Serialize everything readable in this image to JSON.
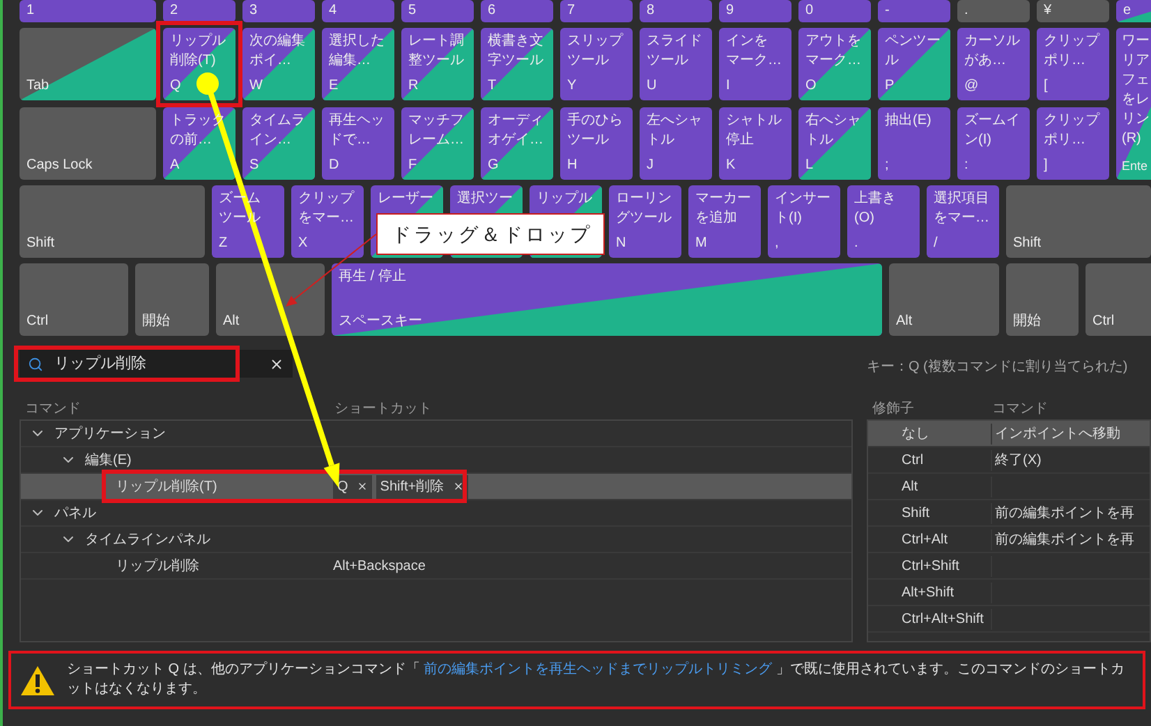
{
  "keyboard": {
    "rows": [
      [
        {
          "key": "1",
          "kind": "app"
        },
        {
          "key": "2",
          "kind": "app"
        },
        {
          "key": "3",
          "kind": "app"
        },
        {
          "key": "4",
          "kind": "app"
        },
        {
          "key": "5",
          "kind": "app"
        },
        {
          "key": "6",
          "kind": "app"
        },
        {
          "key": "7",
          "kind": "app"
        },
        {
          "key": "8",
          "kind": "app"
        },
        {
          "key": "9",
          "kind": "app"
        },
        {
          "key": "0",
          "kind": "app"
        },
        {
          "key": "-",
          "kind": "app"
        },
        {
          "key": ".",
          "kind": "none"
        },
        {
          "key": "¥",
          "kind": "none"
        },
        {
          "key": "e",
          "kind": "both"
        }
      ],
      [
        {
          "key": "Tab",
          "kind": "panel"
        },
        {
          "key": "Q",
          "lines": [
            "リップル",
            "削除(T)"
          ],
          "kind": "both",
          "highlighted": true
        },
        {
          "key": "W",
          "lines": [
            "次の編集",
            "ポイ…"
          ],
          "kind": "both"
        },
        {
          "key": "E",
          "lines": [
            "選択した",
            "編集…"
          ],
          "kind": "both"
        },
        {
          "key": "R",
          "lines": [
            "レート調",
            "整ツール"
          ],
          "kind": "both"
        },
        {
          "key": "T",
          "lines": [
            "横書き文",
            "字ツール"
          ],
          "kind": "both"
        },
        {
          "key": "Y",
          "lines": [
            "スリップ",
            "ツール"
          ],
          "kind": "app"
        },
        {
          "key": "U",
          "lines": [
            "スライド",
            "ツール"
          ],
          "kind": "app"
        },
        {
          "key": "I",
          "lines": [
            "インを",
            "マーク…"
          ],
          "kind": "app"
        },
        {
          "key": "O",
          "lines": [
            "アウトを",
            "マーク…"
          ],
          "kind": "both"
        },
        {
          "key": "P",
          "lines": [
            "ペンツー",
            "ル"
          ],
          "kind": "both"
        },
        {
          "key": "@",
          "lines": [
            "カーソル",
            "があ…"
          ],
          "kind": "app"
        },
        {
          "key": "[",
          "lines": [
            "クリップ",
            "ポリ…"
          ],
          "kind": "app"
        }
      ],
      [
        {
          "key": "Caps Lock",
          "kind": "none"
        },
        {
          "key": "A",
          "lines": [
            "トラック",
            "の前…"
          ],
          "kind": "both"
        },
        {
          "key": "S",
          "lines": [
            "タイムラ",
            "イン…"
          ],
          "kind": "both"
        },
        {
          "key": "D",
          "lines": [
            "再生ヘッ",
            "ドで…"
          ],
          "kind": "app"
        },
        {
          "key": "F",
          "lines": [
            "マッチフ",
            "レーム…"
          ],
          "kind": "both"
        },
        {
          "key": "G",
          "lines": [
            "オーディ",
            "オゲイ…"
          ],
          "kind": "both"
        },
        {
          "key": "H",
          "lines": [
            "手のひら",
            "ツール"
          ],
          "kind": "app"
        },
        {
          "key": "J",
          "lines": [
            "左へシャ",
            "トル"
          ],
          "kind": "app"
        },
        {
          "key": "K",
          "lines": [
            "シャトル",
            "停止"
          ],
          "kind": "app"
        },
        {
          "key": "L",
          "lines": [
            "右へシャ",
            "トル"
          ],
          "kind": "both"
        },
        {
          "key": ";",
          "lines": [
            "抽出(E)"
          ],
          "kind": "app"
        },
        {
          "key": ":",
          "lines": [
            "ズームイ",
            "ン(I)"
          ],
          "kind": "app"
        },
        {
          "key": "]",
          "lines": [
            "クリップ",
            "ポリ…"
          ],
          "kind": "app"
        }
      ],
      [
        {
          "key": "Shift",
          "kind": "none"
        },
        {
          "key": "Z",
          "lines": [
            "ズーム",
            "ツール"
          ],
          "kind": "app"
        },
        {
          "key": "X",
          "lines": [
            "クリップ",
            "をマー…"
          ],
          "kind": "app"
        },
        {
          "lines": [
            "レーザー"
          ],
          "kind": "both"
        },
        {
          "lines": [
            "選択ツー"
          ],
          "kind": "both"
        },
        {
          "lines": [
            "リップル"
          ],
          "kind": "both"
        },
        {
          "key": "N",
          "lines": [
            "ローリン",
            "グツール"
          ],
          "kind": "app"
        },
        {
          "key": "M",
          "lines": [
            "マーカー",
            "を追加"
          ],
          "kind": "app"
        },
        {
          "key": ",",
          "lines": [
            "インサー",
            "ト(I)"
          ],
          "kind": "app"
        },
        {
          "key": ".",
          "lines": [
            "上書き",
            "(O)"
          ],
          "kind": "app"
        },
        {
          "key": "/",
          "lines": [
            "選択項目",
            "をマー…"
          ],
          "kind": "app"
        },
        {
          "key": "Shift",
          "kind": "none"
        }
      ],
      [
        {
          "key": "Ctrl",
          "kind": "none"
        },
        {
          "key": "開始",
          "kind": "none"
        },
        {
          "key": "Alt",
          "kind": "none"
        },
        {
          "key": "スペースキー",
          "lines": [
            "再生 / 停止"
          ],
          "kind": "both"
        },
        {
          "key": "Alt",
          "kind": "none"
        },
        {
          "key": "開始",
          "kind": "none"
        },
        {
          "key": "Ctrl",
          "kind": "none"
        }
      ]
    ],
    "enter": {
      "key": "Ente",
      "lines": [
        "ワー",
        "リア",
        "フェ",
        "をレ",
        "リン",
        "(R)"
      ],
      "kind": "both"
    }
  },
  "callout": "ドラッグ＆ドロップ",
  "search": {
    "value": "リップル削除",
    "highlighted": true
  },
  "key_info": "キー：Q (複数コマンドに割り当てられた)",
  "commands": {
    "columns": [
      "コマンド",
      "ショートカット"
    ],
    "tree": [
      {
        "label": "アプリケーション",
        "expanded": true,
        "children": [
          {
            "label": "編集(E)",
            "expanded": true,
            "children": [
              {
                "label": "リップル削除(T)",
                "selected": true,
                "highlighted": true,
                "shortcuts": [
                  "Q",
                  "Shift+削除"
                ]
              }
            ]
          }
        ]
      },
      {
        "label": "パネル",
        "expanded": true,
        "children": [
          {
            "label": "タイムラインパネル",
            "expanded": true,
            "children": [
              {
                "label": "リップル削除",
                "selected": false,
                "shortcuts": [
                  "Alt+Backspace"
                ]
              }
            ]
          }
        ]
      }
    ]
  },
  "modifiers": {
    "columns": [
      "修飾子",
      "コマンド"
    ],
    "rows": [
      {
        "modifier": "なし",
        "command": "インポイントへ移動",
        "selected": true
      },
      {
        "modifier": "Ctrl",
        "command": "終了(X)",
        "selected": false
      },
      {
        "modifier": "Alt",
        "selected": false
      },
      {
        "modifier": "Shift",
        "command": "前の編集ポイントを再",
        "selected": false
      },
      {
        "modifier": "Ctrl+Alt",
        "command": "前の編集ポイントを再",
        "selected": false
      },
      {
        "modifier": "Ctrl+Shift",
        "selected": false
      },
      {
        "modifier": "Alt+Shift",
        "selected": false
      },
      {
        "modifier": "Ctrl+Alt+Shift",
        "selected": false
      }
    ]
  },
  "message": {
    "highlighted": true,
    "before": "ショートカット Q は、他のアプリケーションコマンド「",
    "link": "前の編集ポイントを再生ヘッドまでリップルトリミング",
    "after": "」で既に使用されています。このコマンドのショートカットはなくなります。"
  }
}
